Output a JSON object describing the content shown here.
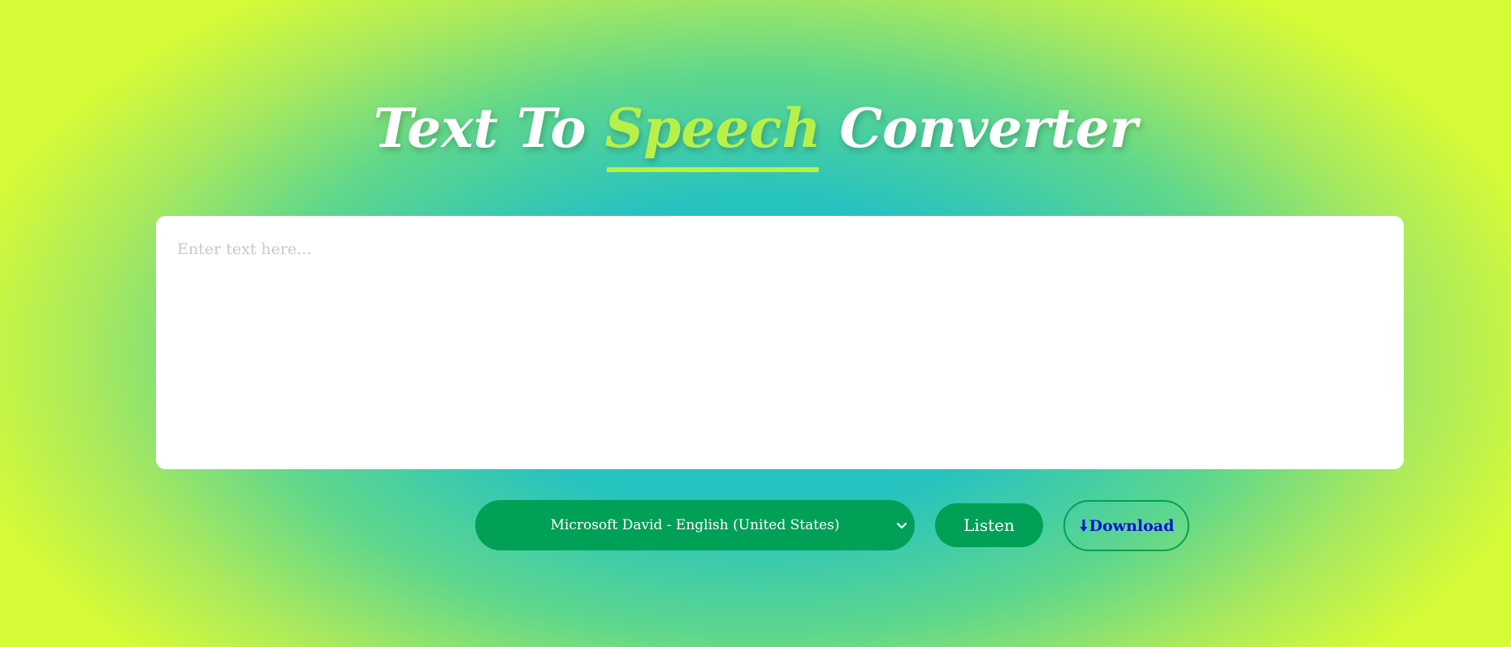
{
  "header": {
    "title_part1": "Text To ",
    "title_accent": "Speech",
    "title_part2": " Converter"
  },
  "editor": {
    "placeholder": "Enter text here...",
    "value": ""
  },
  "controls": {
    "voice_selected": "Microsoft David - English (United States)",
    "listen_label": "Listen",
    "download_label": "Download",
    "download_icon": "arrow-down-icon"
  },
  "colors": {
    "accent": "#b8f04a",
    "button_green": "#00a057",
    "download_text": "#0a13d6",
    "bg_center": "#1fc1c6",
    "bg_edge": "#d6fb37"
  }
}
